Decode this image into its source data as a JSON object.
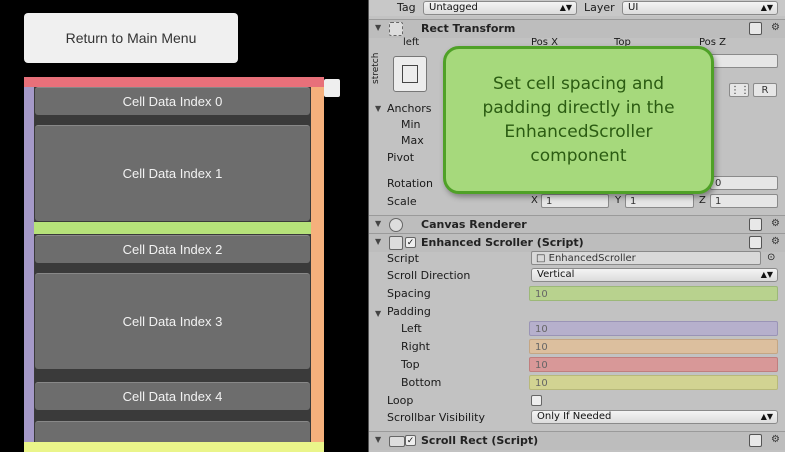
{
  "game_view": {
    "menu_button": "Return to Main Menu",
    "cells": [
      {
        "label": "Cell Data Index 0"
      },
      {
        "label": "Cell Data Index 1"
      },
      {
        "label": "Cell Data Index 2"
      },
      {
        "label": "Cell Data Index 3"
      },
      {
        "label": "Cell Data Index 4"
      },
      {
        "label": ""
      }
    ],
    "colors": {
      "spacing": "#b6e27a",
      "pad_left": "#a599c8",
      "pad_right": "#f5b07c",
      "pad_top": "#e8707a",
      "pad_bottom": "#eaf58a"
    }
  },
  "inspector": {
    "top_row": {
      "tag_label": "Tag",
      "tag_value": "Untagged",
      "layer_label": "Layer",
      "layer_value": "UI"
    },
    "rect_transform": {
      "title": "Rect Transform",
      "left_label": "left",
      "posx_label": "Pos X",
      "top_label": "Top",
      "posz_label": "Pos Z",
      "stretch_label": "stretch",
      "anchors_label": "Anchors",
      "min_label": "Min",
      "max_label": "Max",
      "pivot_label": "Pivot",
      "rotation_label": "Rotation",
      "rotation_z": "0",
      "scale_label": "Scale",
      "scale": {
        "x_label": "X",
        "x": "1",
        "y_label": "Y",
        "y": "1",
        "z_label": "Z",
        "z": "1"
      },
      "r_button": "R"
    },
    "canvas_renderer": {
      "title": "Canvas Renderer"
    },
    "enhanced_scroller": {
      "title": "Enhanced Scroller (Script)",
      "script_label": "Script",
      "script_value": "EnhancedScroller",
      "scroll_direction_label": "Scroll Direction",
      "scroll_direction_value": "Vertical",
      "spacing_label": "Spacing",
      "spacing_value": "10",
      "padding_label": "Padding",
      "left_label": "Left",
      "left_value": "10",
      "right_label": "Right",
      "right_value": "10",
      "top_label": "Top",
      "top_value": "10",
      "bottom_label": "Bottom",
      "bottom_value": "10",
      "loop_label": "Loop",
      "scrollbar_visibility_label": "Scrollbar Visibility",
      "scrollbar_visibility_value": "Only If Needed"
    },
    "scroll_rect": {
      "title": "Scroll Rect (Script)"
    }
  },
  "callout": {
    "text": "Set cell spacing and padding directly in the EnhancedScroller component"
  }
}
